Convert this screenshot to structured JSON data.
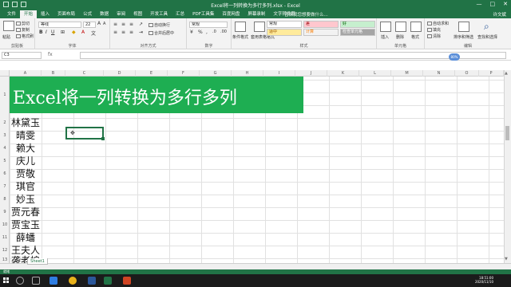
{
  "window": {
    "title": "Excel将一列转换为多行多列.xlsx - Excel",
    "user": "许文斌",
    "controls": {
      "minimize": "—",
      "restore": "□",
      "close": "✕"
    }
  },
  "tabs": [
    "文件",
    "开始",
    "插入",
    "页面布局",
    "公式",
    "数据",
    "审阅",
    "视图",
    "开发工具",
    "汇总",
    "PDF工具集",
    "百度网盘",
    "屏幕录制",
    "文字转换器"
  ],
  "active_tab": "开始",
  "tell_me": "告诉我您想要做什么...",
  "ribbon": {
    "clipboard": {
      "paste": "粘贴",
      "cut": "剪切",
      "copy": "复制",
      "format_painter": "格式刷",
      "label": "剪贴板"
    },
    "font": {
      "name": "等线",
      "size": "22",
      "label": "字体"
    },
    "alignment": {
      "wrap": "自动换行",
      "merge": "合并后居中",
      "label": "对齐方式"
    },
    "number": {
      "format": "常规",
      "label": "数字"
    },
    "styles": {
      "conditional": "条件格式",
      "table": "套用表格格式",
      "cells": [
        {
          "text": "常规",
          "bg": "#ffffff"
        },
        {
          "text": "差",
          "bg": "#ffc7ce"
        },
        {
          "text": "好",
          "bg": "#c6efce"
        },
        {
          "text": "适中",
          "bg": "#ffeb9c"
        },
        {
          "text": "计算",
          "bg": "#f2f2f2"
        },
        {
          "text": "检查单元格",
          "bg": "#a5a5a5"
        }
      ],
      "label": "样式"
    },
    "cells": {
      "insert": "插入",
      "delete": "删除",
      "format": "格式",
      "label": "单元格"
    },
    "editing": {
      "autosum": "自动求和",
      "fill": "填充",
      "clear": "清除",
      "sort": "排序和筛选",
      "find": "查找和选择",
      "label": "编辑"
    }
  },
  "formula_bar": {
    "name_box": "C3",
    "fx": "fx",
    "badge": "80%"
  },
  "columns": [
    "A",
    "B",
    "C",
    "D",
    "E",
    "F",
    "G",
    "H",
    "I",
    "J",
    "K",
    "L",
    "M",
    "N",
    "O",
    "P"
  ],
  "rows": [
    "1",
    "2",
    "3",
    "4",
    "5",
    "6",
    "7",
    "8",
    "9",
    "10",
    "11",
    "12",
    "13"
  ],
  "banner_text": "Excel将一列转换为多行多列",
  "names": [
    "林黛玉",
    "晴雯",
    "赖大",
    "庆儿",
    "贾敬",
    "琪官",
    "妙玉",
    "贾元春",
    "贾宝玉",
    "薛蟠",
    "王夫人",
    "袭老娘"
  ],
  "sheet_tab": "Sheet1",
  "status": "就绪",
  "clock": {
    "time": "18:51:00",
    "date": "2020/11/10"
  },
  "colors": {
    "brand": "#217346",
    "banner": "#1eae52"
  }
}
